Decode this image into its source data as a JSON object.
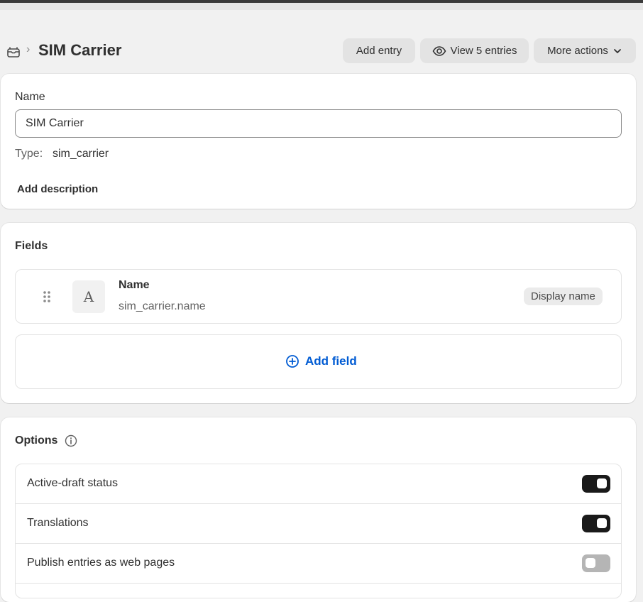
{
  "header": {
    "title": "SIM Carrier",
    "separator": "›",
    "buttons": {
      "add_entry": "Add entry",
      "view_entries": "View 5 entries",
      "more_actions": "More actions"
    }
  },
  "definition": {
    "name_label": "Name",
    "name_value": "SIM Carrier",
    "type_label": "Type:",
    "type_value": "sim_carrier",
    "add_description": "Add description"
  },
  "fields": {
    "title": "Fields",
    "items": [
      {
        "type_glyph": "A",
        "name": "Name",
        "key": "sim_carrier.name",
        "badge": "Display name"
      }
    ],
    "add_field": "Add field"
  },
  "options": {
    "title": "Options",
    "items": [
      {
        "label": "Active-draft status",
        "enabled": true
      },
      {
        "label": "Translations",
        "enabled": true
      },
      {
        "label": "Publish entries as web pages",
        "enabled": false
      }
    ]
  },
  "colors": {
    "background": "#f1f1f1",
    "card": "#ffffff",
    "button": "#e3e3e3",
    "link": "#005bd3",
    "toggle_on": "#1a1a1a",
    "toggle_off": "#b5b5b5"
  },
  "icons": {
    "breadcrumb": "metaobject-icon",
    "view": "eye-icon",
    "more": "chevron-down-icon",
    "drag": "drag-handle-icon",
    "add": "plus-circle-icon",
    "info": "info-icon"
  }
}
